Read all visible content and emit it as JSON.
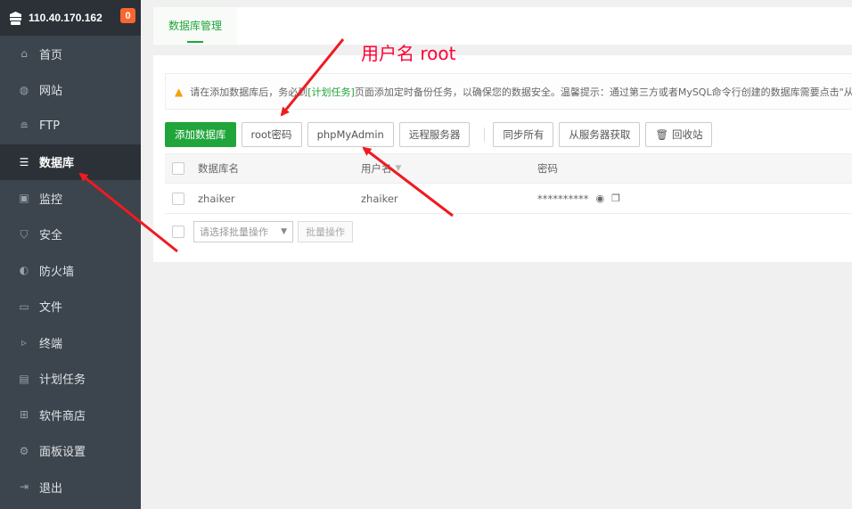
{
  "header": {
    "server_ip": "110.40.170.162",
    "notify_count": "0"
  },
  "sidebar": {
    "items": [
      {
        "label": "首页",
        "icon": "home-icon"
      },
      {
        "label": "网站",
        "icon": "globe-icon"
      },
      {
        "label": "FTP",
        "icon": "ftp-icon"
      },
      {
        "label": "数据库",
        "icon": "database-icon",
        "active": true
      },
      {
        "label": "监控",
        "icon": "monitor-icon"
      },
      {
        "label": "安全",
        "icon": "shield-icon"
      },
      {
        "label": "防火墙",
        "icon": "firewall-icon"
      },
      {
        "label": "文件",
        "icon": "folder-icon"
      },
      {
        "label": "终端",
        "icon": "terminal-icon"
      },
      {
        "label": "计划任务",
        "icon": "calendar-icon"
      },
      {
        "label": "软件商店",
        "icon": "apps-icon"
      },
      {
        "label": "面板设置",
        "icon": "gear-icon"
      },
      {
        "label": "退出",
        "icon": "logout-icon"
      }
    ]
  },
  "tabs": {
    "db_manage": "数据库管理"
  },
  "alert": {
    "text_before": "请在添加数据库后，务必到",
    "link": "[计划任务]",
    "text_after": "页面添加定时备份任务，以确保您的数据安全。温馨提示：通过第三方或者MySQL命令行创建的数据库需要点击\"从服"
  },
  "toolbar": {
    "add_db": "添加数据库",
    "root_password": "root密码",
    "phpmyadmin": "phpMyAdmin",
    "remote_server": "远程服务器",
    "sync_all": "同步所有",
    "fetch_from_server": "从服务器获取",
    "recycle_bin": "回收站"
  },
  "table": {
    "headers": {
      "name": "数据库名",
      "user": "用户名",
      "password": "密码"
    },
    "rows": [
      {
        "name": "zhaiker",
        "user": "zhaiker",
        "password": "**********"
      }
    ]
  },
  "batch": {
    "placeholder": "请选择批量操作",
    "action": "批量操作"
  },
  "annotation": {
    "text": "用户名 root",
    "color": "#ff0033"
  },
  "colors": {
    "accent": "#20a53a",
    "sidebar": "#3c444d",
    "badge": "#f7672f"
  }
}
